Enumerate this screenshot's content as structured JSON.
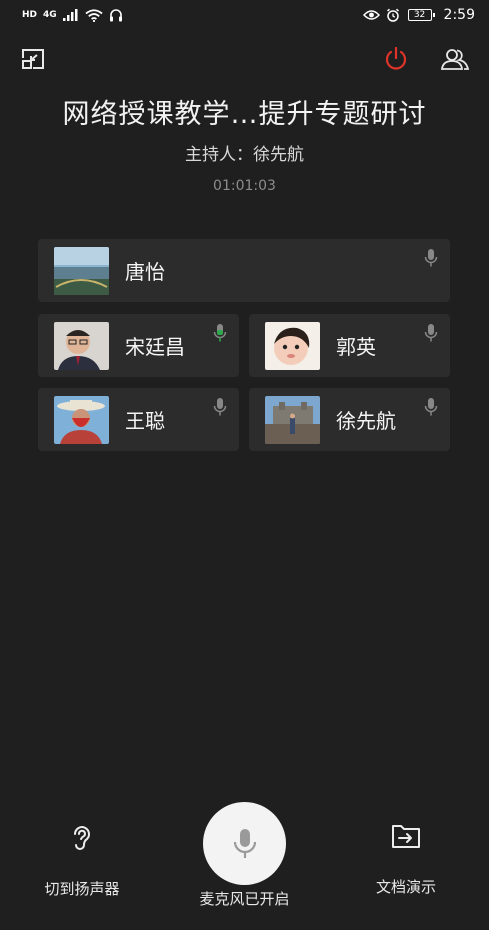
{
  "status_bar": {
    "left_hd": "HD",
    "left_network": "4G",
    "battery": "32",
    "time": "2:59"
  },
  "meeting": {
    "title": "网络授课教学…提升专题研讨",
    "host": "主持人：徐先航",
    "timer": "01:01:03"
  },
  "participants": [
    {
      "name": "唐怡",
      "mic_active": false
    },
    {
      "name": "宋廷昌",
      "mic_active": true
    },
    {
      "name": "郭英",
      "mic_active": false
    },
    {
      "name": "王聪",
      "mic_active": false
    },
    {
      "name": "徐先航",
      "mic_active": false
    }
  ],
  "bottom_bar": {
    "speaker_label": "切到扬声器",
    "mic_label": "麦克风已开启",
    "share_label": "文档演示"
  },
  "colors": {
    "background": "#1f1f1f",
    "card": "#2c2c2c",
    "power_red": "#e0342b",
    "mic_active_green": "#2fa84f"
  }
}
